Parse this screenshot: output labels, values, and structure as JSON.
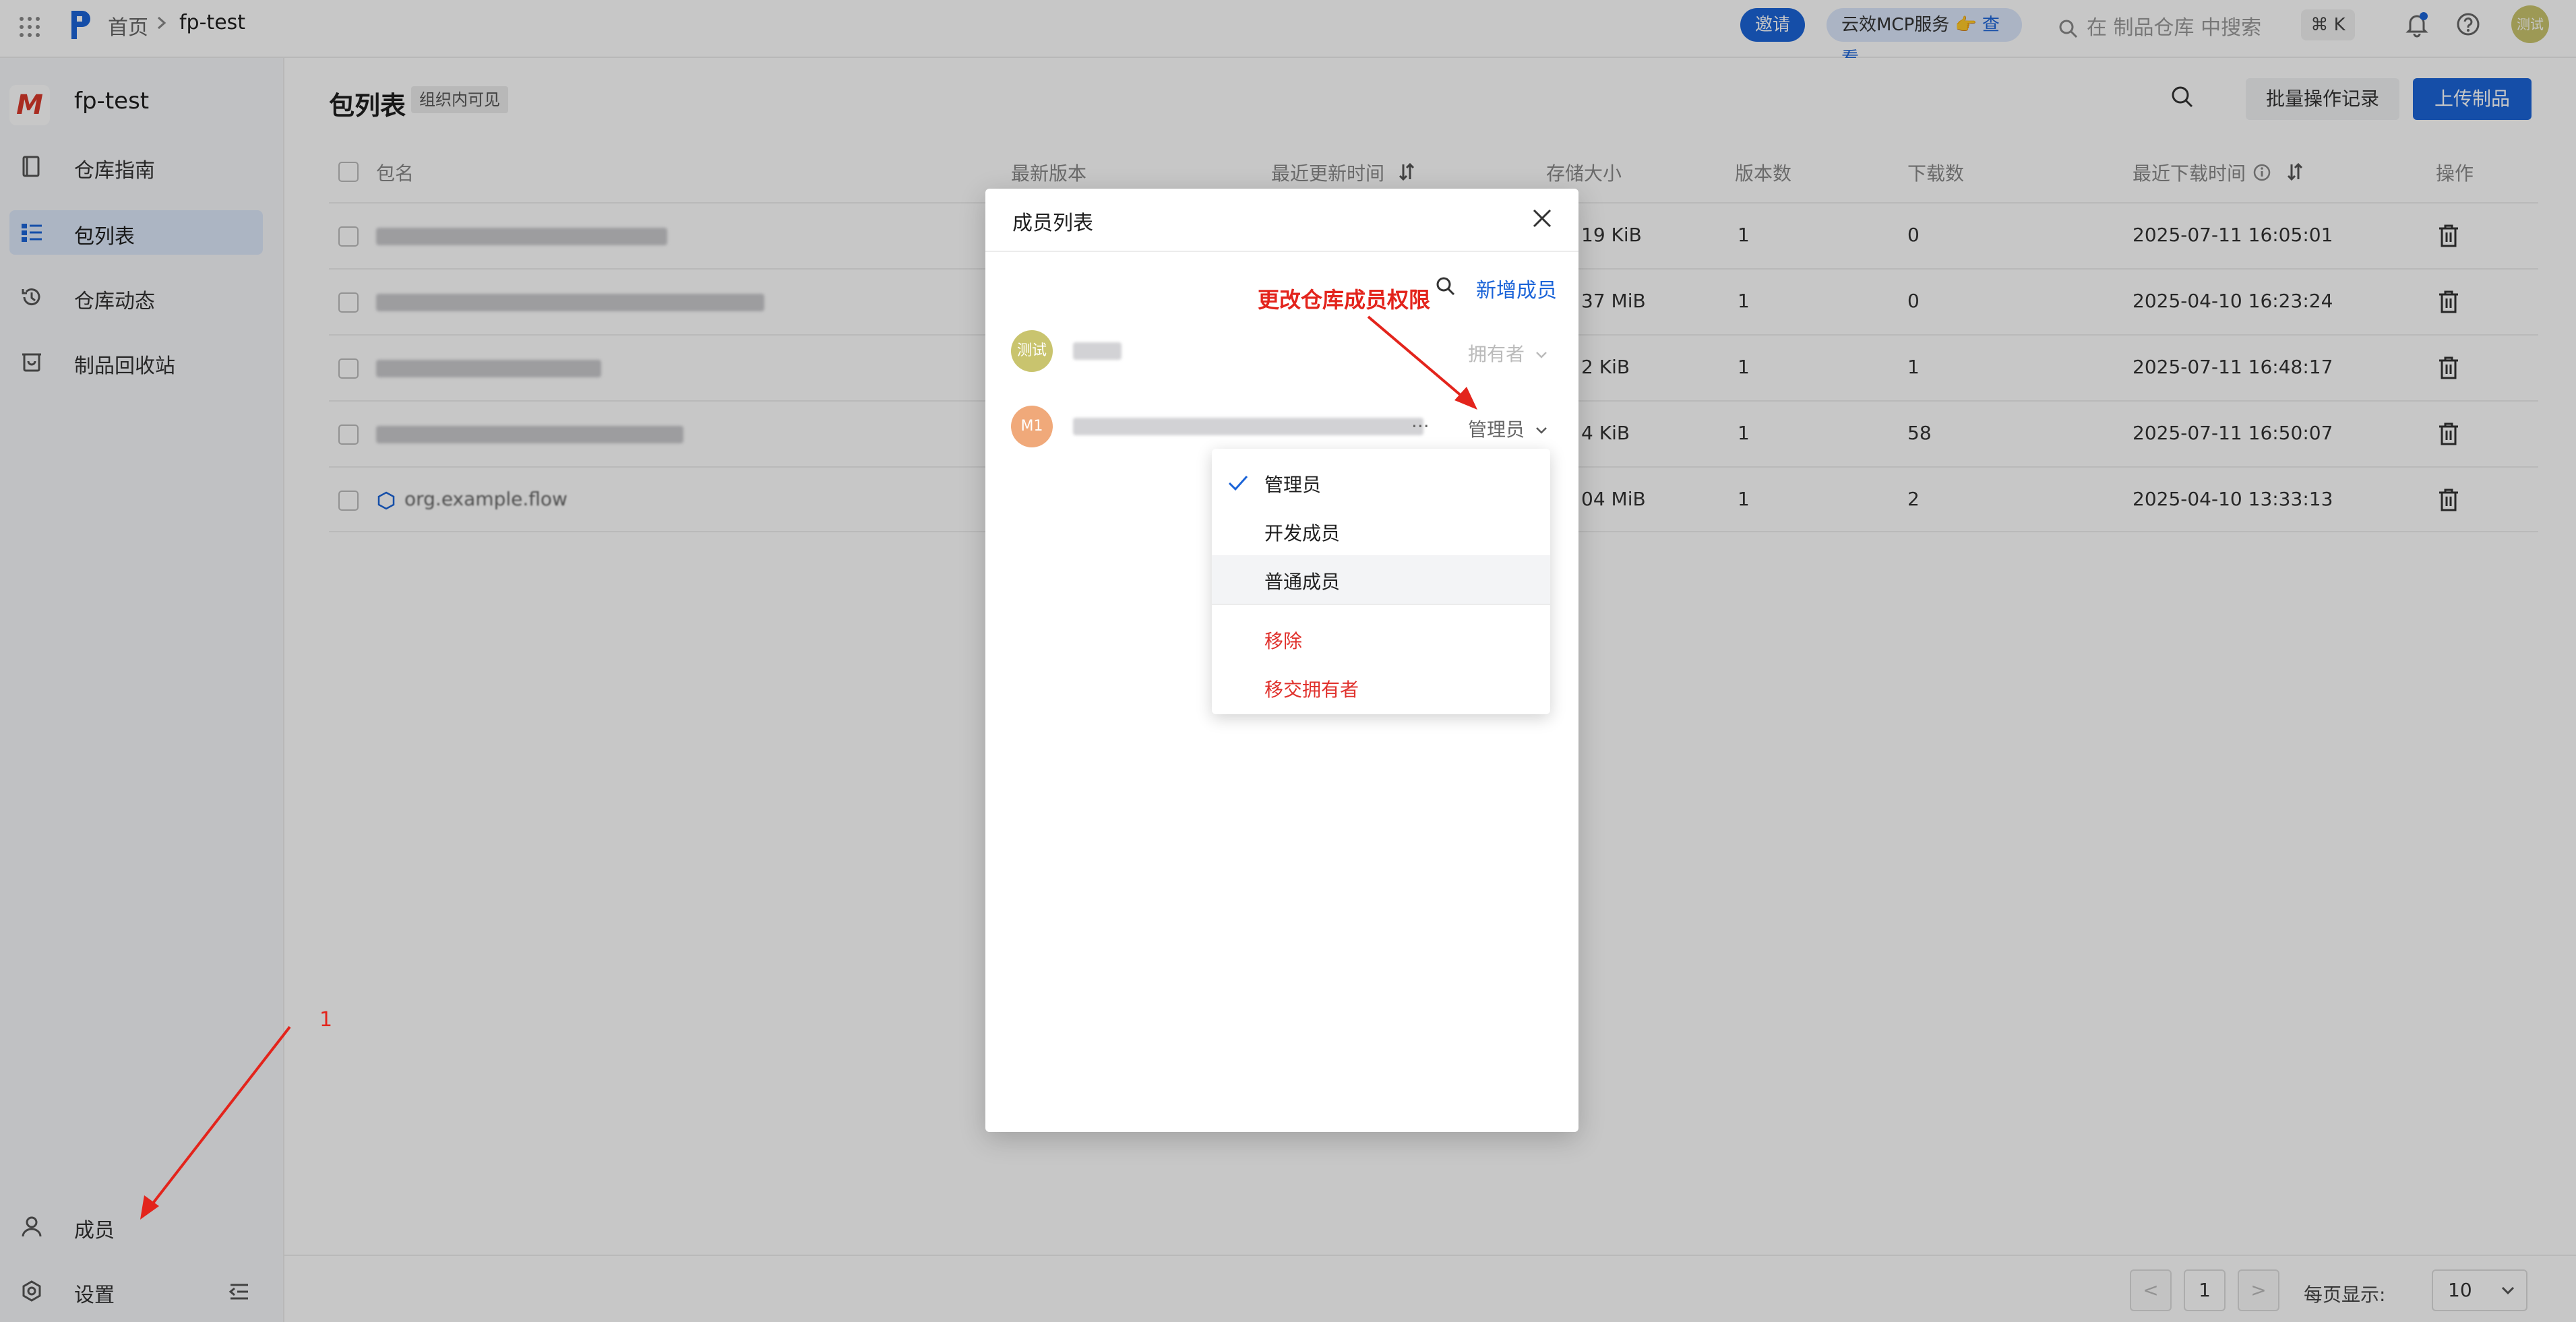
{
  "topbar": {
    "breadcrumb_home": "首页",
    "breadcrumb_current": "fp-test",
    "invite_label": "邀请",
    "mcp_label": "云效MCP服务 👉",
    "mcp_link": "查看",
    "search_placeholder": "在 制品仓库 中搜索",
    "shortcut": "⌘ K",
    "avatar_text": "测试"
  },
  "sidebar": {
    "repo_logo": "M",
    "repo_name": "fp-test",
    "items": [
      {
        "label": "仓库指南",
        "icon": "book-icon"
      },
      {
        "label": "包列表",
        "icon": "list-icon",
        "active": true
      },
      {
        "label": "仓库动态",
        "icon": "history-icon"
      },
      {
        "label": "制品回收站",
        "icon": "recycle-icon"
      }
    ],
    "members_label": "成员",
    "settings_label": "设置"
  },
  "main": {
    "title": "包列表",
    "visibility_badge": "组织内可见",
    "batch_button": "批量操作记录",
    "upload_button": "上传制品",
    "columns": [
      "包名",
      "最新版本",
      "最近更新时间",
      "存储大小",
      "版本数",
      "下载数",
      "最近下载时间",
      "操作"
    ],
    "rows": [
      {
        "size_suffix": "19 KiB",
        "versions": "1",
        "downloads": "0",
        "last_download": "2025-07-11 16:05:01"
      },
      {
        "size_suffix": "37 MiB",
        "versions": "1",
        "downloads": "0",
        "last_download": "2025-04-10 16:23:24"
      },
      {
        "size_suffix": "2 KiB",
        "versions": "1",
        "downloads": "1",
        "last_download": "2025-07-11 16:48:17"
      },
      {
        "size_suffix": "4 KiB",
        "versions": "1",
        "downloads": "58",
        "last_download": "2025-07-11 16:50:07"
      },
      {
        "name": "org.example.flow",
        "size_suffix": "04 MiB",
        "versions": "1",
        "downloads": "2",
        "last_download": "2025-04-10 13:33:13"
      }
    ],
    "pager": {
      "prev": "<",
      "page": "1",
      "next": ">",
      "per_page_label": "每页显示:",
      "per_page_value": "10"
    }
  },
  "modal": {
    "title": "成员列表",
    "add_member": "新增成员",
    "members": [
      {
        "avatar": "测试",
        "role": "拥有者",
        "avatar_color": "#c9c46e"
      },
      {
        "avatar": "M1",
        "role": "管理员",
        "avatar_color": "#f0a97a"
      }
    ],
    "ellipsis": "..."
  },
  "dropdown": {
    "options": [
      "管理员",
      "开发成员",
      "普通成员"
    ],
    "selected": "管理员",
    "actions": [
      "移除",
      "移交拥有者"
    ]
  },
  "annotations": {
    "role_hint": "更改仓库成员权限",
    "step_number": "1"
  },
  "colors": {
    "primary": "#1b64d8",
    "danger": "#e0312c",
    "annotation": "#e3241c"
  }
}
